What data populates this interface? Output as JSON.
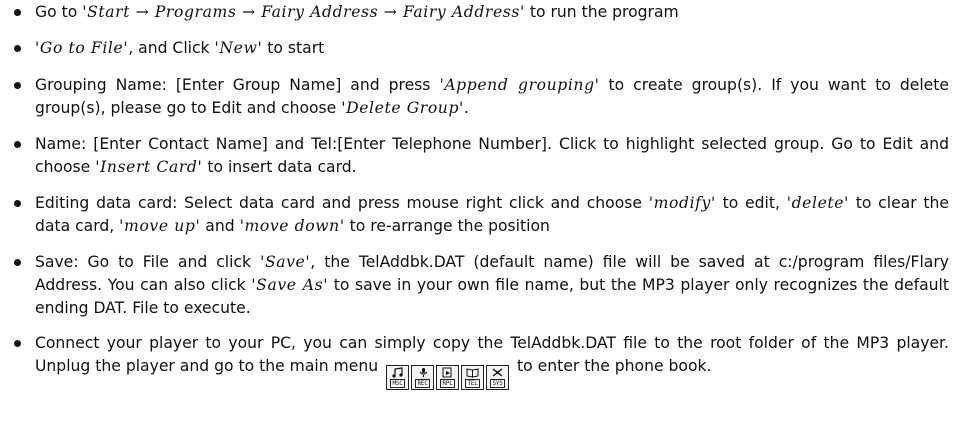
{
  "steps": [
    {
      "segments": [
        {
          "t": "Go to "
        },
        {
          "t": "'Start → Programs → Fairy Address → Fairy Address'",
          "c": 1
        },
        {
          "t": " to run the program"
        }
      ]
    },
    {
      "segments": [
        {
          "t": "'Go to File'",
          "c": 1
        },
        {
          "t": ", and Click "
        },
        {
          "t": "'New'",
          "c": 1
        },
        {
          "t": " to start"
        }
      ]
    },
    {
      "segments": [
        {
          "t": "Grouping Name: [Enter Group Name] and press "
        },
        {
          "t": "'Append grouping'",
          "c": 1
        },
        {
          "t": " to create group(s). If you want to delete group(s), please go to Edit and choose "
        },
        {
          "t": "'Delete Group'",
          "c": 1
        },
        {
          "t": "."
        }
      ]
    },
    {
      "segments": [
        {
          "t": "Name: [Enter Contact Name] and Tel:[Enter Telephone Number]. Click to highlight selected group. Go to Edit and choose "
        },
        {
          "t": "'Insert Card'",
          "c": 1
        },
        {
          "t": " to insert data card."
        }
      ]
    },
    {
      "segments": [
        {
          "t": "Editing data card: Select data card and press mouse right click and choose "
        },
        {
          "t": "'modify'",
          "c": 1
        },
        {
          "t": " to edit, "
        },
        {
          "t": "'delete'",
          "c": 1
        },
        {
          "t": " to clear the data card, "
        },
        {
          "t": "'move up'",
          "c": 1
        },
        {
          "t": " and "
        },
        {
          "t": "'move down'",
          "c": 1
        },
        {
          "t": " to re-arrange the position"
        }
      ]
    },
    {
      "segments": [
        {
          "t": "Save: Go to File and click "
        },
        {
          "t": "'Save'",
          "c": 1
        },
        {
          "t": ", the TelAddbk.DAT (default name) file will be saved at c:/program files/Flary Address. You can also click "
        },
        {
          "t": "'Save As'",
          "c": 1
        },
        {
          "t": " to save in your own file name, but the MP3 player only recognizes the default ending DAT. File to execute."
        }
      ]
    },
    {
      "segments": [
        {
          "t": "Connect your player to your PC, you can simply copy the TelAddbk.DAT file to the root folder of the MP3 player. Unplug the player and go to the main menu"
        },
        {
          "icons": 1
        },
        {
          "t": "to enter the phone book."
        }
      ]
    }
  ],
  "menu_icons": [
    {
      "label": "MSC",
      "icon": "music-note-icon"
    },
    {
      "label": "REC",
      "icon": "microphone-icon"
    },
    {
      "label": "RPL",
      "icon": "replay-icon"
    },
    {
      "label": "TEL",
      "icon": "phonebook-icon"
    },
    {
      "label": "SYS",
      "icon": "system-icon"
    }
  ]
}
